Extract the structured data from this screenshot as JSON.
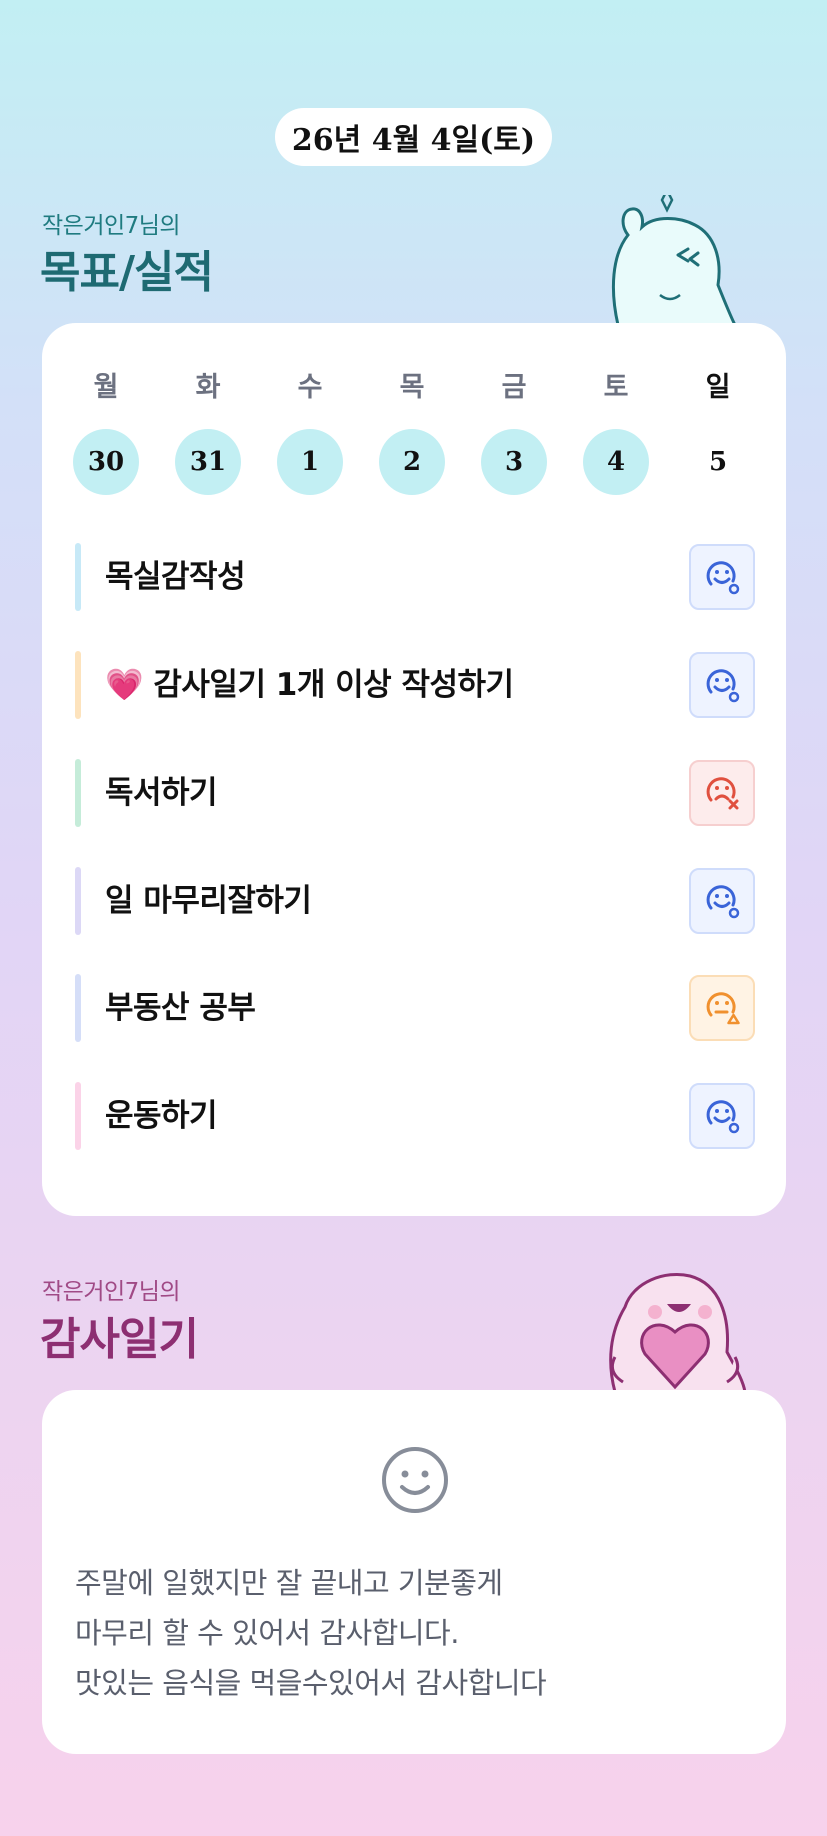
{
  "header": {
    "date": "26년 4월 4일(토)"
  },
  "goals_section": {
    "subtitle": "작은거인7님의",
    "title": "목표/실적"
  },
  "week": {
    "days": [
      {
        "label": "월",
        "num": "30",
        "filled": true
      },
      {
        "label": "화",
        "num": "31",
        "filled": true
      },
      {
        "label": "수",
        "num": "1",
        "filled": true
      },
      {
        "label": "목",
        "num": "2",
        "filled": true
      },
      {
        "label": "금",
        "num": "3",
        "filled": true
      },
      {
        "label": "토",
        "num": "4",
        "filled": true
      },
      {
        "label": "일",
        "num": "5",
        "filled": false
      }
    ]
  },
  "goals": [
    {
      "text": "목실감작성",
      "status": "achieved",
      "bar_color": "#c7e9f7",
      "icon": "smile-circle-icon"
    },
    {
      "text": "💗 감사일기 1개 이상 작성하기",
      "status": "achieved",
      "bar_color": "#fde3bd",
      "icon": "smile-circle-icon"
    },
    {
      "text": "독서하기",
      "status": "failed",
      "bar_color": "#c5ecd9",
      "icon": "frown-x-icon"
    },
    {
      "text": "일 마무리잘하기",
      "status": "achieved",
      "bar_color": "#dcd8f6",
      "icon": "smile-circle-icon"
    },
    {
      "text": "부동산 공부",
      "status": "partial",
      "bar_color": "#d5def8",
      "icon": "meh-triangle-icon"
    },
    {
      "text": "운동하기",
      "status": "achieved",
      "bar_color": "#fbd3e8",
      "icon": "smile-circle-icon"
    }
  ],
  "thanks_section": {
    "subtitle": "작은거인7님의",
    "title": "감사일기"
  },
  "thanks": {
    "icon": "smile-icon",
    "lines": [
      "주말에 일했지만 잘 끝내고 기분좋게",
      "마무리 할 수 있어서 감사합니다.",
      "맛있는 음식을 먹을수있어서 감사합니다"
    ]
  },
  "colors": {
    "good": "#3a64d8",
    "bad": "#e0503f",
    "meh": "#f0902e",
    "goal_title": "#1e6a72",
    "thanks_title": "#8d2f72"
  }
}
